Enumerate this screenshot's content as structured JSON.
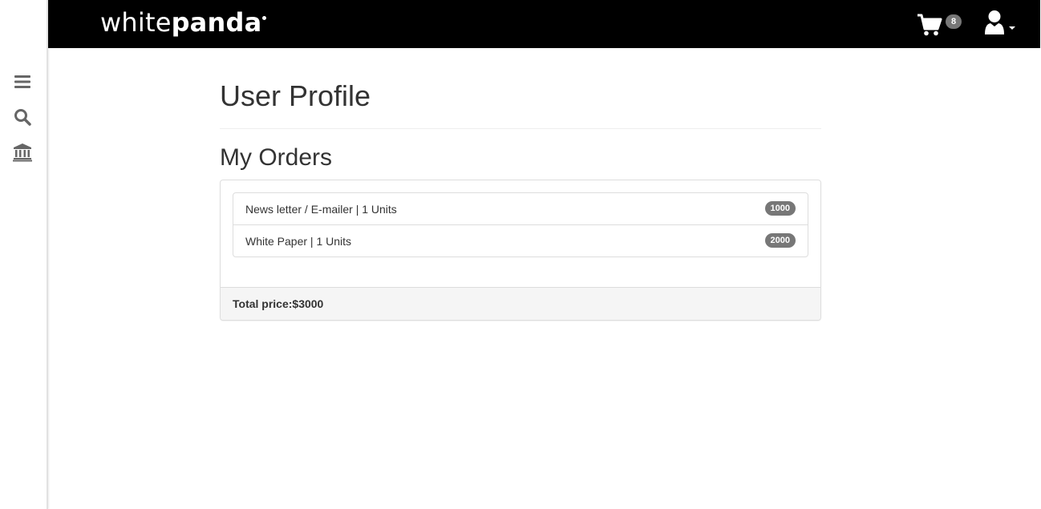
{
  "brand": {
    "logo_part1": "white",
    "logo_part2": "panda"
  },
  "header": {
    "cart_icon": "shopping-cart-icon",
    "cart_count": "8",
    "user_icon": "user-icon"
  },
  "sidebar": {
    "items": [
      {
        "icon": "bars-icon"
      },
      {
        "icon": "search-icon"
      },
      {
        "icon": "bank-icon"
      }
    ]
  },
  "page": {
    "title": "User Profile",
    "section_title": "My Orders"
  },
  "orders": {
    "items": [
      {
        "label": "News letter / E-mailer | 1 Units",
        "price": "1000"
      },
      {
        "label": "White Paper | 1 Units",
        "price": "2000"
      }
    ],
    "total": "Total price:$3000"
  },
  "colors": {
    "topbar": "#000000",
    "badge": "#777777",
    "text": "#333333",
    "footer_bg": "#f5f5f5"
  }
}
